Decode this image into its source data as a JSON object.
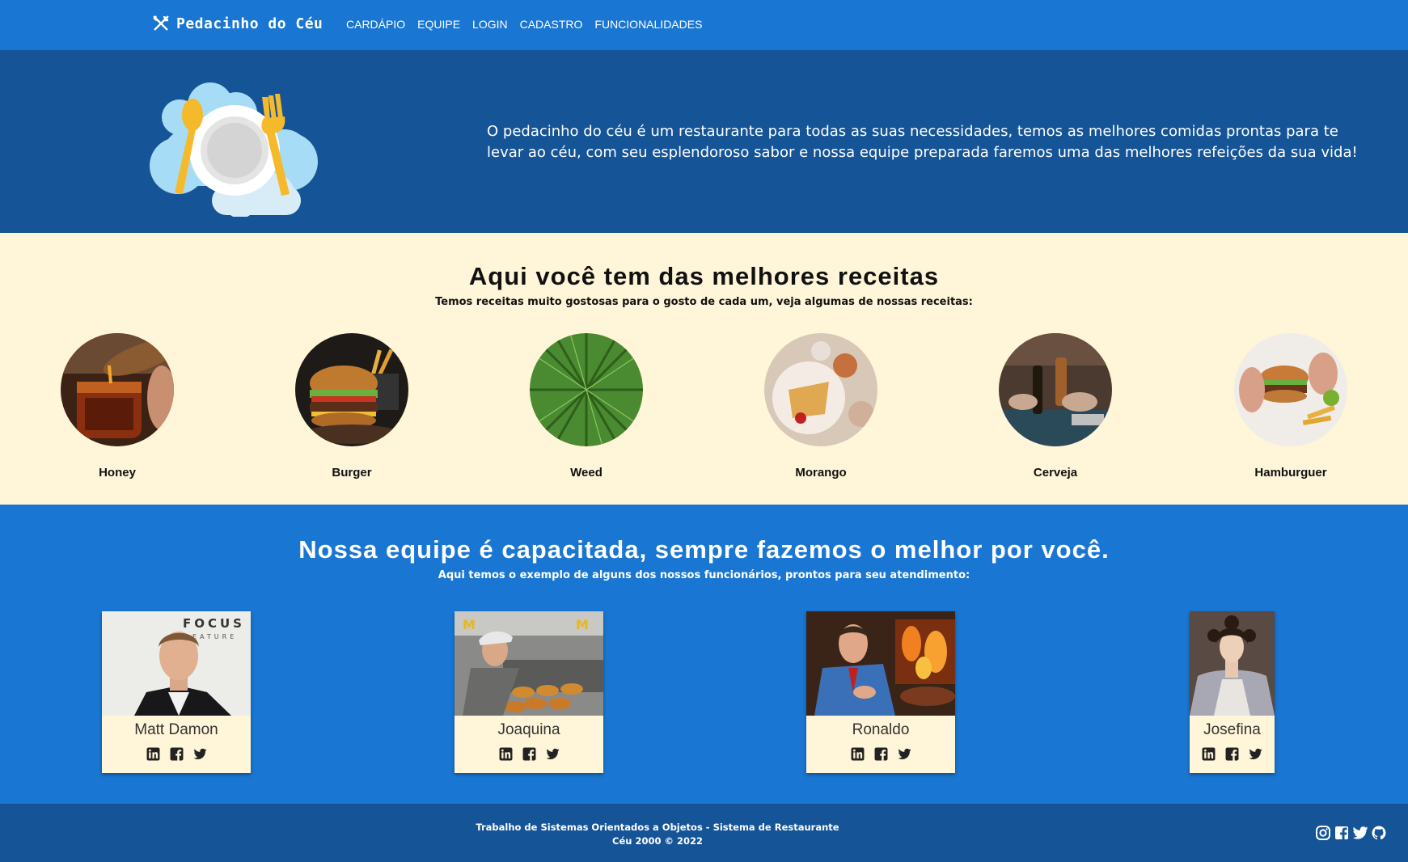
{
  "nav": {
    "brand": "Pedacinho do Céu",
    "links": [
      "CARDÁPIO",
      "EQUIPE",
      "LOGIN",
      "CADASTRO",
      "FUNCIONALIDADES"
    ]
  },
  "hero": {
    "text": "O pedacinho do céu é um restaurante para todas as suas necessidades, temos as melhores comidas prontas para te levar ao céu, com seu esplendoroso sabor e nossa equipe preparada faremos uma das melhores refeições da sua vida!"
  },
  "recipes": {
    "title": "Aqui você tem das melhores receitas",
    "subtitle": "Temos receitas muito gostosas para o gosto de cada um, veja algumas de nossas receitas:",
    "items": [
      {
        "name": "Honey"
      },
      {
        "name": "Burger"
      },
      {
        "name": "Weed"
      },
      {
        "name": "Morango"
      },
      {
        "name": "Cerveja"
      },
      {
        "name": "Hamburguer"
      }
    ]
  },
  "team": {
    "title": "Nossa equipe é capacitada, sempre fazemos o melhor por você.",
    "subtitle": "Aqui temos o exemplo de alguns dos nossos funcionários, prontos para seu atendimento:",
    "members": [
      {
        "name": "Matt Damon"
      },
      {
        "name": "Joaquina"
      },
      {
        "name": "Ronaldo"
      },
      {
        "name": "Josefina"
      }
    ]
  },
  "footer": {
    "line1": "Trabalho de Sistemas Orientados a Objetos - Sistema de Restaurante",
    "line2": "Céu 2000 © 2022"
  },
  "colors": {
    "nav_bg": "#1976d2",
    "hero_bg": "#155496",
    "cream": "#fff5d8",
    "footer_bg": "#155496"
  },
  "icons": [
    "utensils-icon",
    "linkedin-icon",
    "facebook-icon",
    "twitter-icon",
    "instagram-icon",
    "github-icon"
  ]
}
